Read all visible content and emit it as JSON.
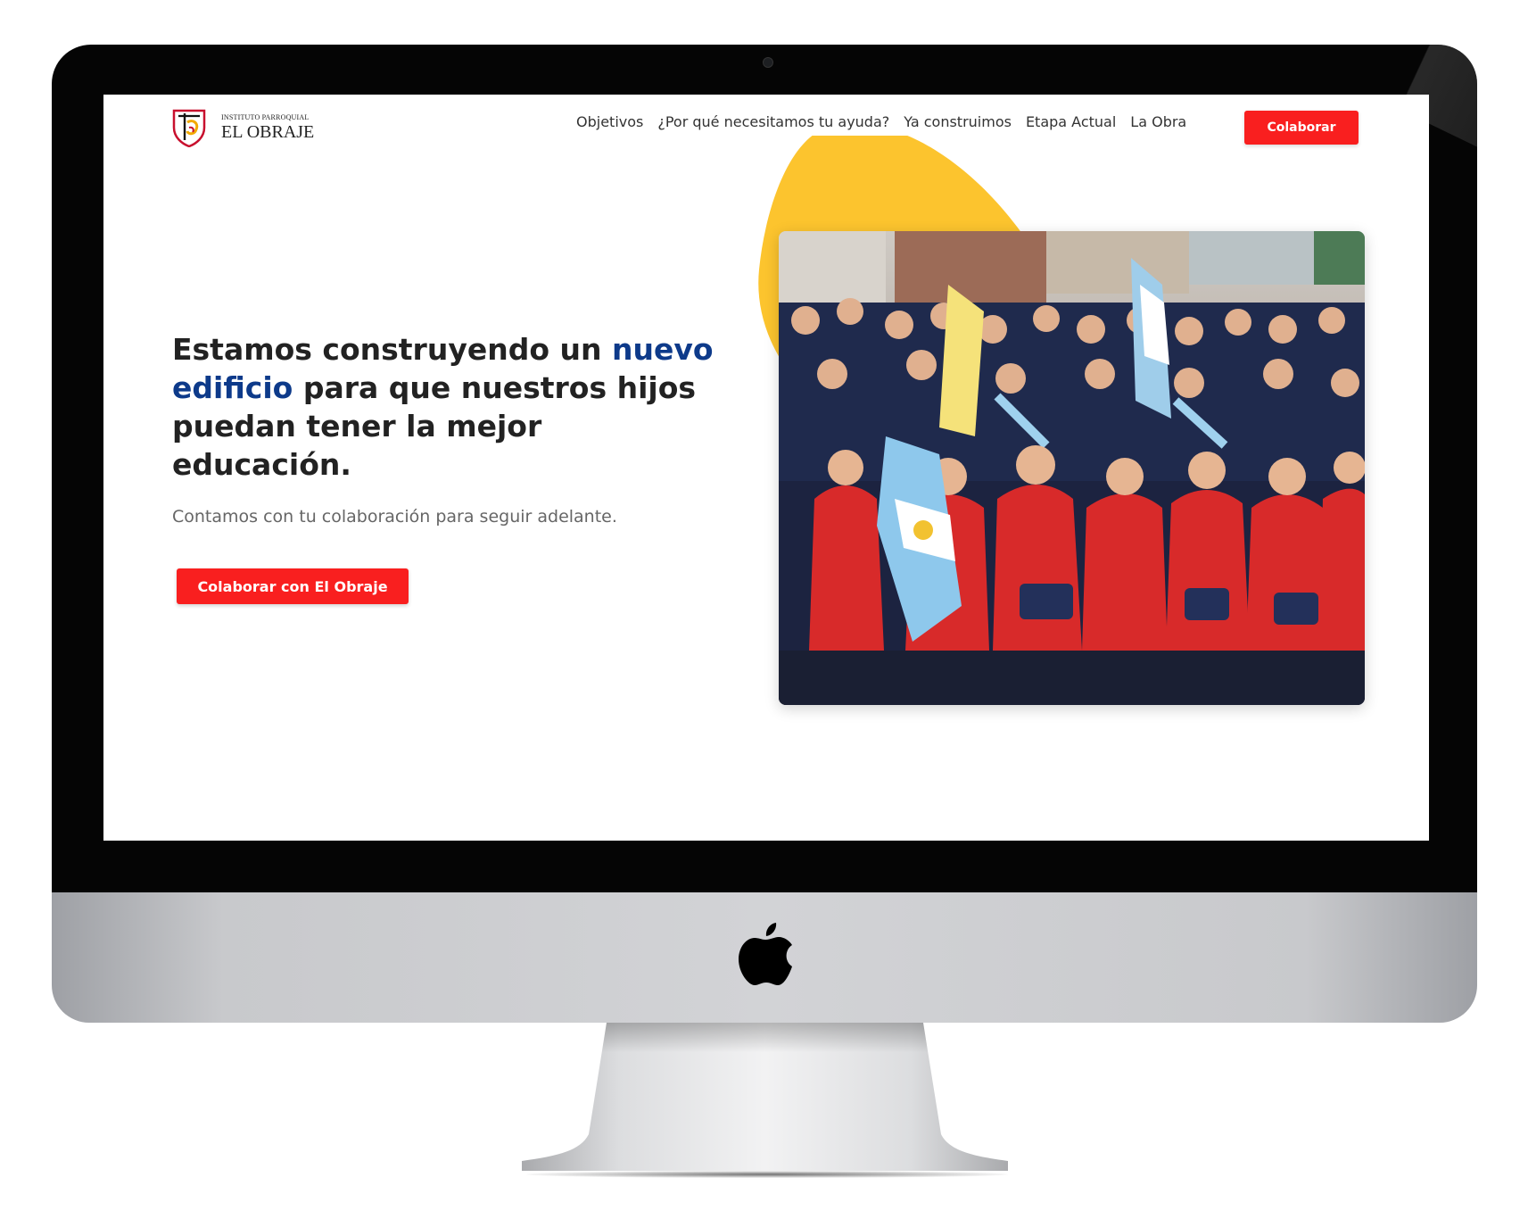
{
  "brand": {
    "small_text": "INSTITUTO PARROQUIAL",
    "name": "EL OBRAJE"
  },
  "nav": {
    "links": [
      {
        "label": "Objetivos"
      },
      {
        "label": "¿Por qué necesitamos tu ayuda?"
      },
      {
        "label": "Ya construimos"
      },
      {
        "label": "Etapa Actual"
      },
      {
        "label": "La Obra"
      }
    ],
    "cta_label": "Colaborar"
  },
  "hero": {
    "title_before": "Estamos construyendo un ",
    "title_highlight": "nuevo edificio",
    "title_after": " para que nuestros hijos puedan tener la mejor educación.",
    "subtitle": "Contamos con tu colaboración para seguir adelante.",
    "cta_label": "Colaborar con El Obraje",
    "photo_description_icon": "students-parade-photo"
  },
  "colors": {
    "accent_red": "#f91f1f",
    "highlight_blue": "#0d3a8a",
    "blob_yellow": "#fcc42e",
    "bezel": "#050505",
    "chin_silver": "#cfd0d3"
  }
}
